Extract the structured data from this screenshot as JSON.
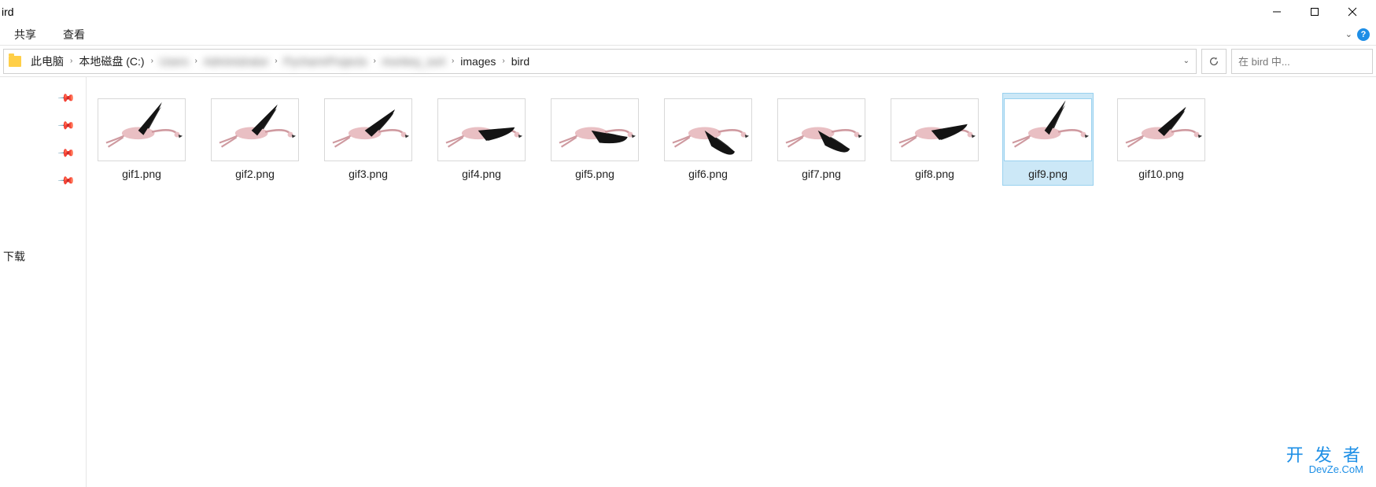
{
  "title": "ird",
  "ribbon": {
    "tabs": [
      "共享",
      "查看"
    ]
  },
  "breadcrumb": {
    "items": [
      {
        "label": "此电脑",
        "blur": false
      },
      {
        "label": "本地磁盘 (C:)",
        "blur": false
      },
      {
        "label": "Users",
        "blur": true
      },
      {
        "label": "Administrator",
        "blur": true
      },
      {
        "label": "PycharmProjects",
        "blur": true
      },
      {
        "label": "monkey_sort",
        "blur": true
      },
      {
        "label": "images",
        "blur": false
      },
      {
        "label": "bird",
        "blur": false
      }
    ]
  },
  "search": {
    "placeholder": "在 bird 中..."
  },
  "sidebar": {
    "pins": [
      1,
      2,
      3,
      4
    ],
    "label": "下载"
  },
  "files": [
    {
      "name": "gif1.png",
      "frame": 1,
      "selected": false
    },
    {
      "name": "gif2.png",
      "frame": 2,
      "selected": false
    },
    {
      "name": "gif3.png",
      "frame": 3,
      "selected": false
    },
    {
      "name": "gif4.png",
      "frame": 4,
      "selected": false
    },
    {
      "name": "gif5.png",
      "frame": 5,
      "selected": false
    },
    {
      "name": "gif6.png",
      "frame": 6,
      "selected": false
    },
    {
      "name": "gif7.png",
      "frame": 7,
      "selected": false
    },
    {
      "name": "gif8.png",
      "frame": 8,
      "selected": false
    },
    {
      "name": "gif9.png",
      "frame": 9,
      "selected": true
    },
    {
      "name": "gif10.png",
      "frame": 10,
      "selected": false
    }
  ],
  "watermark": {
    "line1": "开 发 者",
    "line2": "DevZe.CoM"
  }
}
